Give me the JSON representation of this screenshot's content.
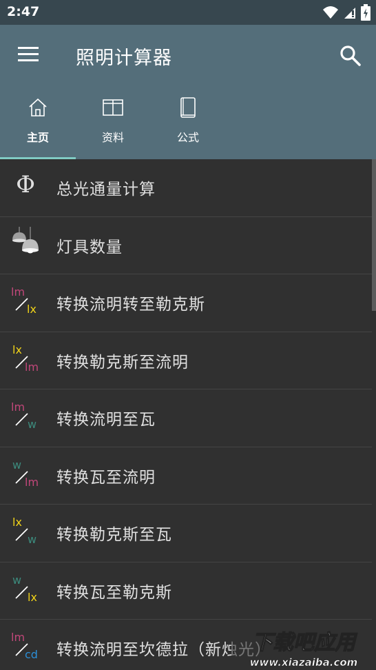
{
  "status": {
    "time": "2:47"
  },
  "app": {
    "title": "照明计算器"
  },
  "tabs": [
    {
      "label": "主页",
      "icon": "home-icon",
      "active": true
    },
    {
      "label": "资料",
      "icon": "table-icon",
      "active": false
    },
    {
      "label": "公式",
      "icon": "book-icon",
      "active": false
    }
  ],
  "items": [
    {
      "label": "总光通量计算",
      "icon": "phi-icon"
    },
    {
      "label": "灯具数量",
      "icon": "lamp-icon"
    },
    {
      "label": "转换流明转至勒克斯",
      "icon": "lm-lx-icon",
      "top": "lm",
      "bottom": "lx"
    },
    {
      "label": "转换勒克斯至流明",
      "icon": "lx-lm-icon",
      "top": "lx",
      "bottom": "lm"
    },
    {
      "label": "转换流明至瓦",
      "icon": "lm-w-icon",
      "top": "lm",
      "bottom": "w"
    },
    {
      "label": "转换瓦至流明",
      "icon": "w-lm-icon",
      "top": "w",
      "bottom": "lm"
    },
    {
      "label": "转换勒克斯至瓦",
      "icon": "lx-w-icon",
      "top": "lx",
      "bottom": "w"
    },
    {
      "label": "转换瓦至勒克斯",
      "icon": "w-lx-icon",
      "top": "w",
      "bottom": "lx"
    },
    {
      "label": "转换流明至坎德拉（新烛光）",
      "icon": "lm-cd-icon",
      "top": "lm",
      "bottom": "cd"
    }
  ],
  "watermark": {
    "text": "下载吧应用",
    "url": "www.xiazaiba.com"
  },
  "colors": {
    "lm": "#c2477a",
    "lx": "#f1d319",
    "w": "#3c8a7c",
    "cd": "#2b8fd8"
  }
}
